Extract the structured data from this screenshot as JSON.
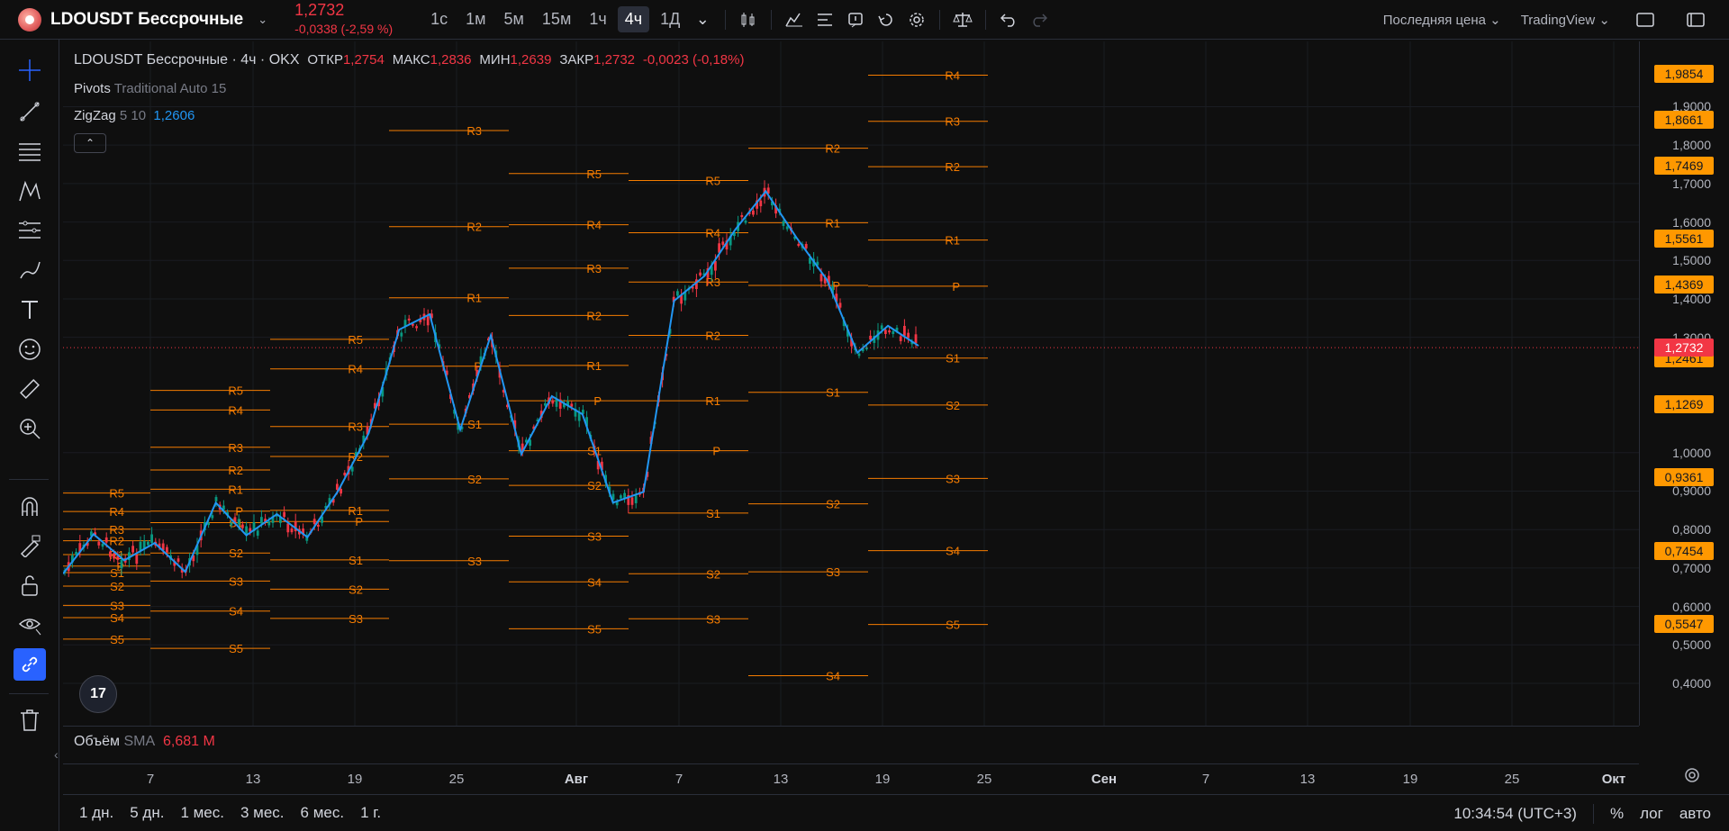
{
  "header": {
    "symbol": "LDOUSDT Бессрочные",
    "price": "1,2732",
    "change": "-0,0338 (-2,59 %)",
    "intervals": [
      "1с",
      "1м",
      "5м",
      "15м",
      "1ч",
      "4ч",
      "1Д"
    ],
    "active_interval": "4ч",
    "price_type": "Последняя цена",
    "broker": "TradingView"
  },
  "legend": {
    "title": "LDOUSDT Бессрочные · 4ч · OKX",
    "open_label": "ОТКР",
    "open": "1,2754",
    "high_label": "МАКС",
    "high": "1,2836",
    "low_label": "МИН",
    "low": "1,2639",
    "close_label": "ЗАКР",
    "close": "1,2732",
    "change": "-0,0023 (-0,18%)",
    "pivots_name": "Pivots",
    "pivots_params": "Traditional Auto 15",
    "zigzag_name": "ZigZag",
    "zigzag_params": "5 10",
    "zigzag_value": "1,2606"
  },
  "volume": {
    "name": "Объём",
    "ma": "SMA",
    "value": "6,681 M"
  },
  "price_axis": {
    "ticks": [
      "1,9000",
      "1,8000",
      "1,7000",
      "1,6000",
      "1,5000",
      "1,4000",
      "1,3000",
      "1,0000",
      "0,9000",
      "0,8000",
      "0,7000",
      "0,6000",
      "0,5000",
      "0,4000"
    ],
    "tick_values": [
      1.9,
      1.8,
      1.7,
      1.6,
      1.5,
      1.4,
      1.3,
      1.0,
      0.9,
      0.8,
      0.7,
      0.6,
      0.5,
      0.4
    ],
    "labels": [
      "1,9854",
      "1,8661",
      "1,7469",
      "1,5561",
      "1,4369",
      "1,2461",
      "1,1269",
      "0,9361",
      "0,7454",
      "0,5547"
    ],
    "label_values": [
      1.9854,
      1.8661,
      1.7469,
      1.5561,
      1.4369,
      1.2461,
      1.1269,
      0.9361,
      0.7454,
      0.5547
    ],
    "current": "1,2732",
    "current_value": 1.2732
  },
  "time_axis": {
    "labels": [
      "7",
      "13",
      "19",
      "25",
      "Авг",
      "7",
      "13",
      "19",
      "25",
      "Сен",
      "7",
      "13",
      "19",
      "25",
      "Окт"
    ],
    "bold_labels": [
      "Авг",
      "Сен",
      "Окт"
    ]
  },
  "ranges": [
    "1 дн.",
    "5 дн.",
    "1 мес.",
    "3 мес.",
    "6 мес.",
    "1 г."
  ],
  "bottom_right": {
    "time": "10:34:54 (UTC+3)",
    "percent": "%",
    "log": "лог",
    "auto": "авто"
  },
  "pivot_level_names": [
    "R5",
    "R4",
    "R3",
    "R2",
    "R1",
    "P",
    "S1",
    "S2",
    "S3",
    "S4",
    "S5"
  ],
  "pivot_blocks": [
    {
      "labels": [
        "R5",
        "R4",
        "R3",
        "R2",
        "R1",
        "P",
        "S1",
        "S2",
        "S3",
        "S4",
        "S5"
      ],
      "values": [
        0.895,
        0.847,
        0.801,
        0.771,
        0.735,
        0.705,
        0.688,
        0.653,
        0.603,
        0.571,
        0.515
      ]
    },
    {
      "labels": [
        "R5",
        "R4",
        "R3",
        "R2",
        "R1",
        "P",
        "S1",
        "S2",
        "S3",
        "S4",
        "S5"
      ],
      "values": [
        1.162,
        1.111,
        1.014,
        0.955,
        0.905,
        0.848,
        0.818,
        0.739,
        0.666,
        0.588,
        0.491
      ]
    },
    {
      "labels": [
        "R5",
        "R4",
        "R3",
        "R2",
        "R1",
        "P",
        "S1",
        "S2",
        "S3"
      ],
      "values": [
        1.295,
        1.218,
        1.068,
        0.99,
        0.85,
        0.821,
        0.721,
        0.645,
        0.569
      ]
    },
    {
      "labels": [
        "R3",
        "R2",
        "R1",
        "P",
        "S1",
        "S2",
        "S3"
      ],
      "values": [
        1.838,
        1.588,
        1.403,
        1.225,
        1.074,
        0.932,
        0.719
      ]
    },
    {
      "labels": [
        "R5",
        "R4",
        "R3",
        "R2",
        "R1",
        "P",
        "S1",
        "S2",
        "S3",
        "S4",
        "S5"
      ],
      "values": [
        1.726,
        1.593,
        1.48,
        1.357,
        1.227,
        1.135,
        1.005,
        0.915,
        0.783,
        0.664,
        0.542
      ]
    },
    {
      "labels": [
        "R5",
        "R4",
        "R3",
        "R2",
        "R1",
        "P",
        "S1",
        "S2",
        "S3"
      ],
      "values": [
        1.708,
        1.572,
        1.444,
        1.305,
        1.135,
        1.005,
        0.843,
        0.685,
        0.568
      ]
    },
    {
      "labels": [
        "R2",
        "R1",
        "P",
        "S1",
        "S2",
        "S3",
        "S4"
      ],
      "values": [
        1.792,
        1.598,
        1.435,
        1.157,
        0.867,
        0.69,
        0.42
      ]
    },
    {
      "labels": [
        "R4",
        "R3",
        "R2",
        "R1",
        "P",
        "S1",
        "S2",
        "S3",
        "S4",
        "S5"
      ],
      "values": [
        1.982,
        1.862,
        1.744,
        1.553,
        1.433,
        1.246,
        1.124,
        0.933,
        0.745,
        0.553
      ]
    }
  ],
  "zigzag_points": [
    0.685,
    0.788,
    0.72,
    0.765,
    0.69,
    0.87,
    0.785,
    0.84,
    0.78,
    0.9,
    1.05,
    1.32,
    1.36,
    1.06,
    1.305,
    0.996,
    1.147,
    1.1,
    0.87,
    0.898,
    1.395,
    1.46,
    1.58,
    1.68,
    1.56,
    1.45,
    1.26,
    1.33,
    1.278
  ],
  "candles_note": ""
}
